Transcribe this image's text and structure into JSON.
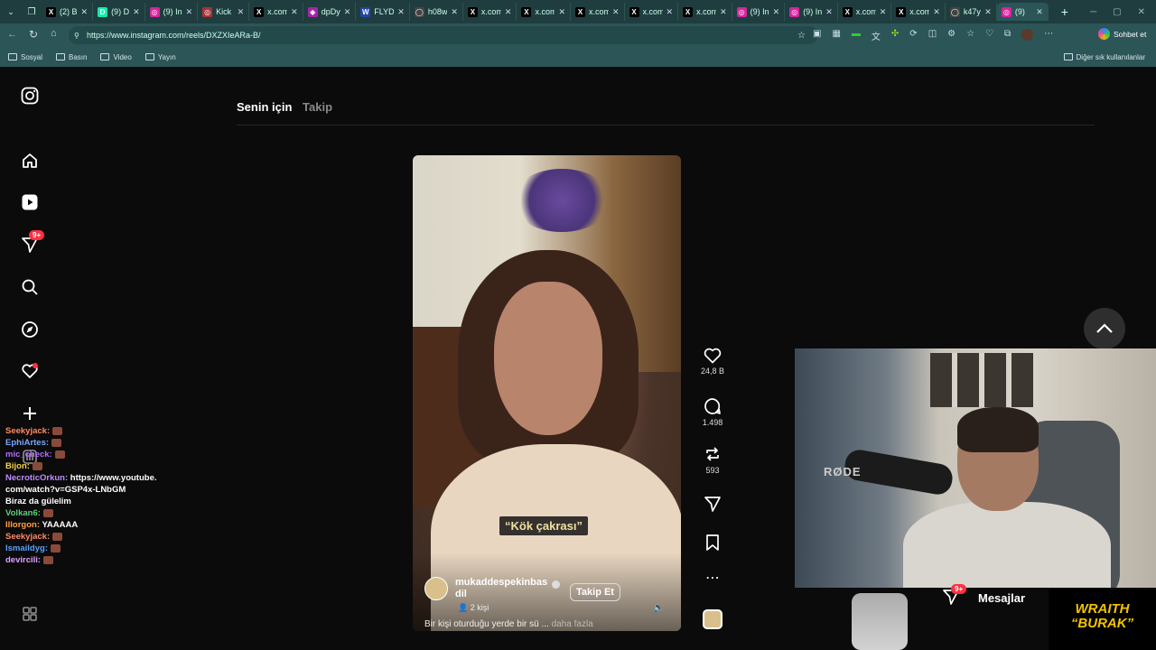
{
  "browser": {
    "tabs": [
      {
        "label": "(2) B",
        "fav": "X",
        "color": "#000"
      },
      {
        "label": "(9) D",
        "fav": "D",
        "color": "#1ea"
      },
      {
        "label": "(9) In",
        "fav": "◎",
        "color": "#d6249f"
      },
      {
        "label": "Kick",
        "fav": "◎",
        "color": "#a33"
      },
      {
        "label": "x.com",
        "fav": "X",
        "color": "#000"
      },
      {
        "label": "dpDy",
        "fav": "◆",
        "color": "#a2a"
      },
      {
        "label": "FLYD",
        "fav": "W",
        "color": "#24a"
      },
      {
        "label": "h08w",
        "fav": "◯",
        "color": "#444"
      },
      {
        "label": "x.com",
        "fav": "X",
        "color": "#000"
      },
      {
        "label": "x.com",
        "fav": "X",
        "color": "#000"
      },
      {
        "label": "x.com",
        "fav": "X",
        "color": "#000"
      },
      {
        "label": "x.com",
        "fav": "X",
        "color": "#000"
      },
      {
        "label": "x.com",
        "fav": "X",
        "color": "#000"
      },
      {
        "label": "(9) In",
        "fav": "◎",
        "color": "#d6249f"
      },
      {
        "label": "(9) In",
        "fav": "◎",
        "color": "#d6249f"
      },
      {
        "label": "x.com",
        "fav": "X",
        "color": "#000"
      },
      {
        "label": "x.com",
        "fav": "X",
        "color": "#000"
      },
      {
        "label": "k47y",
        "fav": "◯",
        "color": "#444"
      },
      {
        "label": "(9)",
        "fav": "◎",
        "color": "#d6249f",
        "active": true
      }
    ],
    "url": "https://www.instagram.com/reels/DXZXIeARa-B/",
    "copilot_label": "Sohbet et",
    "bookmarks": [
      "Sosyal",
      "Basın",
      "Video",
      "Yayın"
    ],
    "other_bookmarks": "Diğer sık kullanılanlar"
  },
  "instagram": {
    "tab_for_you": "Senin için",
    "tab_following": "Takip",
    "notifications_badge": "9+",
    "video": {
      "caption": "“Kök çakrası”",
      "author": "mukaddespekinbasdil",
      "follow_label": "Takip Et",
      "people": "2 kişi",
      "description": "Bir kişi oturduğu yerde bir sü ...",
      "more_label": "daha fazla"
    },
    "actions": {
      "likes": "24,8 B",
      "comments": "1.498",
      "reposts": "593"
    }
  },
  "stream_overlay": {
    "mic_brand": "RØDE",
    "messages_label": "Mesajlar",
    "messages_badge": "9+",
    "brand_line1": "WRAITH",
    "brand_line2": "“BURAK”",
    "chat": [
      {
        "user": "Seekyjack:",
        "color": "#ff8a65",
        "text": ""
      },
      {
        "user": "EphiArtes:",
        "color": "#7aa6ff",
        "text": ""
      },
      {
        "user": "mic_check:",
        "color": "#b36bff",
        "text": ""
      },
      {
        "user": "Bijon:",
        "color": "#ffd24a",
        "text": ""
      },
      {
        "user": "NecroticOrkun:",
        "color": "#c08bff",
        "text": "https://www.youtube.com/watch?v=GSP4x-LNbGM"
      },
      {
        "user": "",
        "color": "#fff",
        "text": "Biraz da gülelim"
      },
      {
        "user": "Volkan6:",
        "color": "#5ad07a",
        "text": ""
      },
      {
        "user": "Illorgon:",
        "color": "#ffa040",
        "text": "YAAAAA"
      },
      {
        "user": "Seekyjack:",
        "color": "#ff8a65",
        "text": ""
      },
      {
        "user": "lsmaildyg:",
        "color": "#5aa0ff",
        "text": ""
      },
      {
        "user": "devircili:",
        "color": "#e0a0ff",
        "text": ""
      }
    ]
  }
}
